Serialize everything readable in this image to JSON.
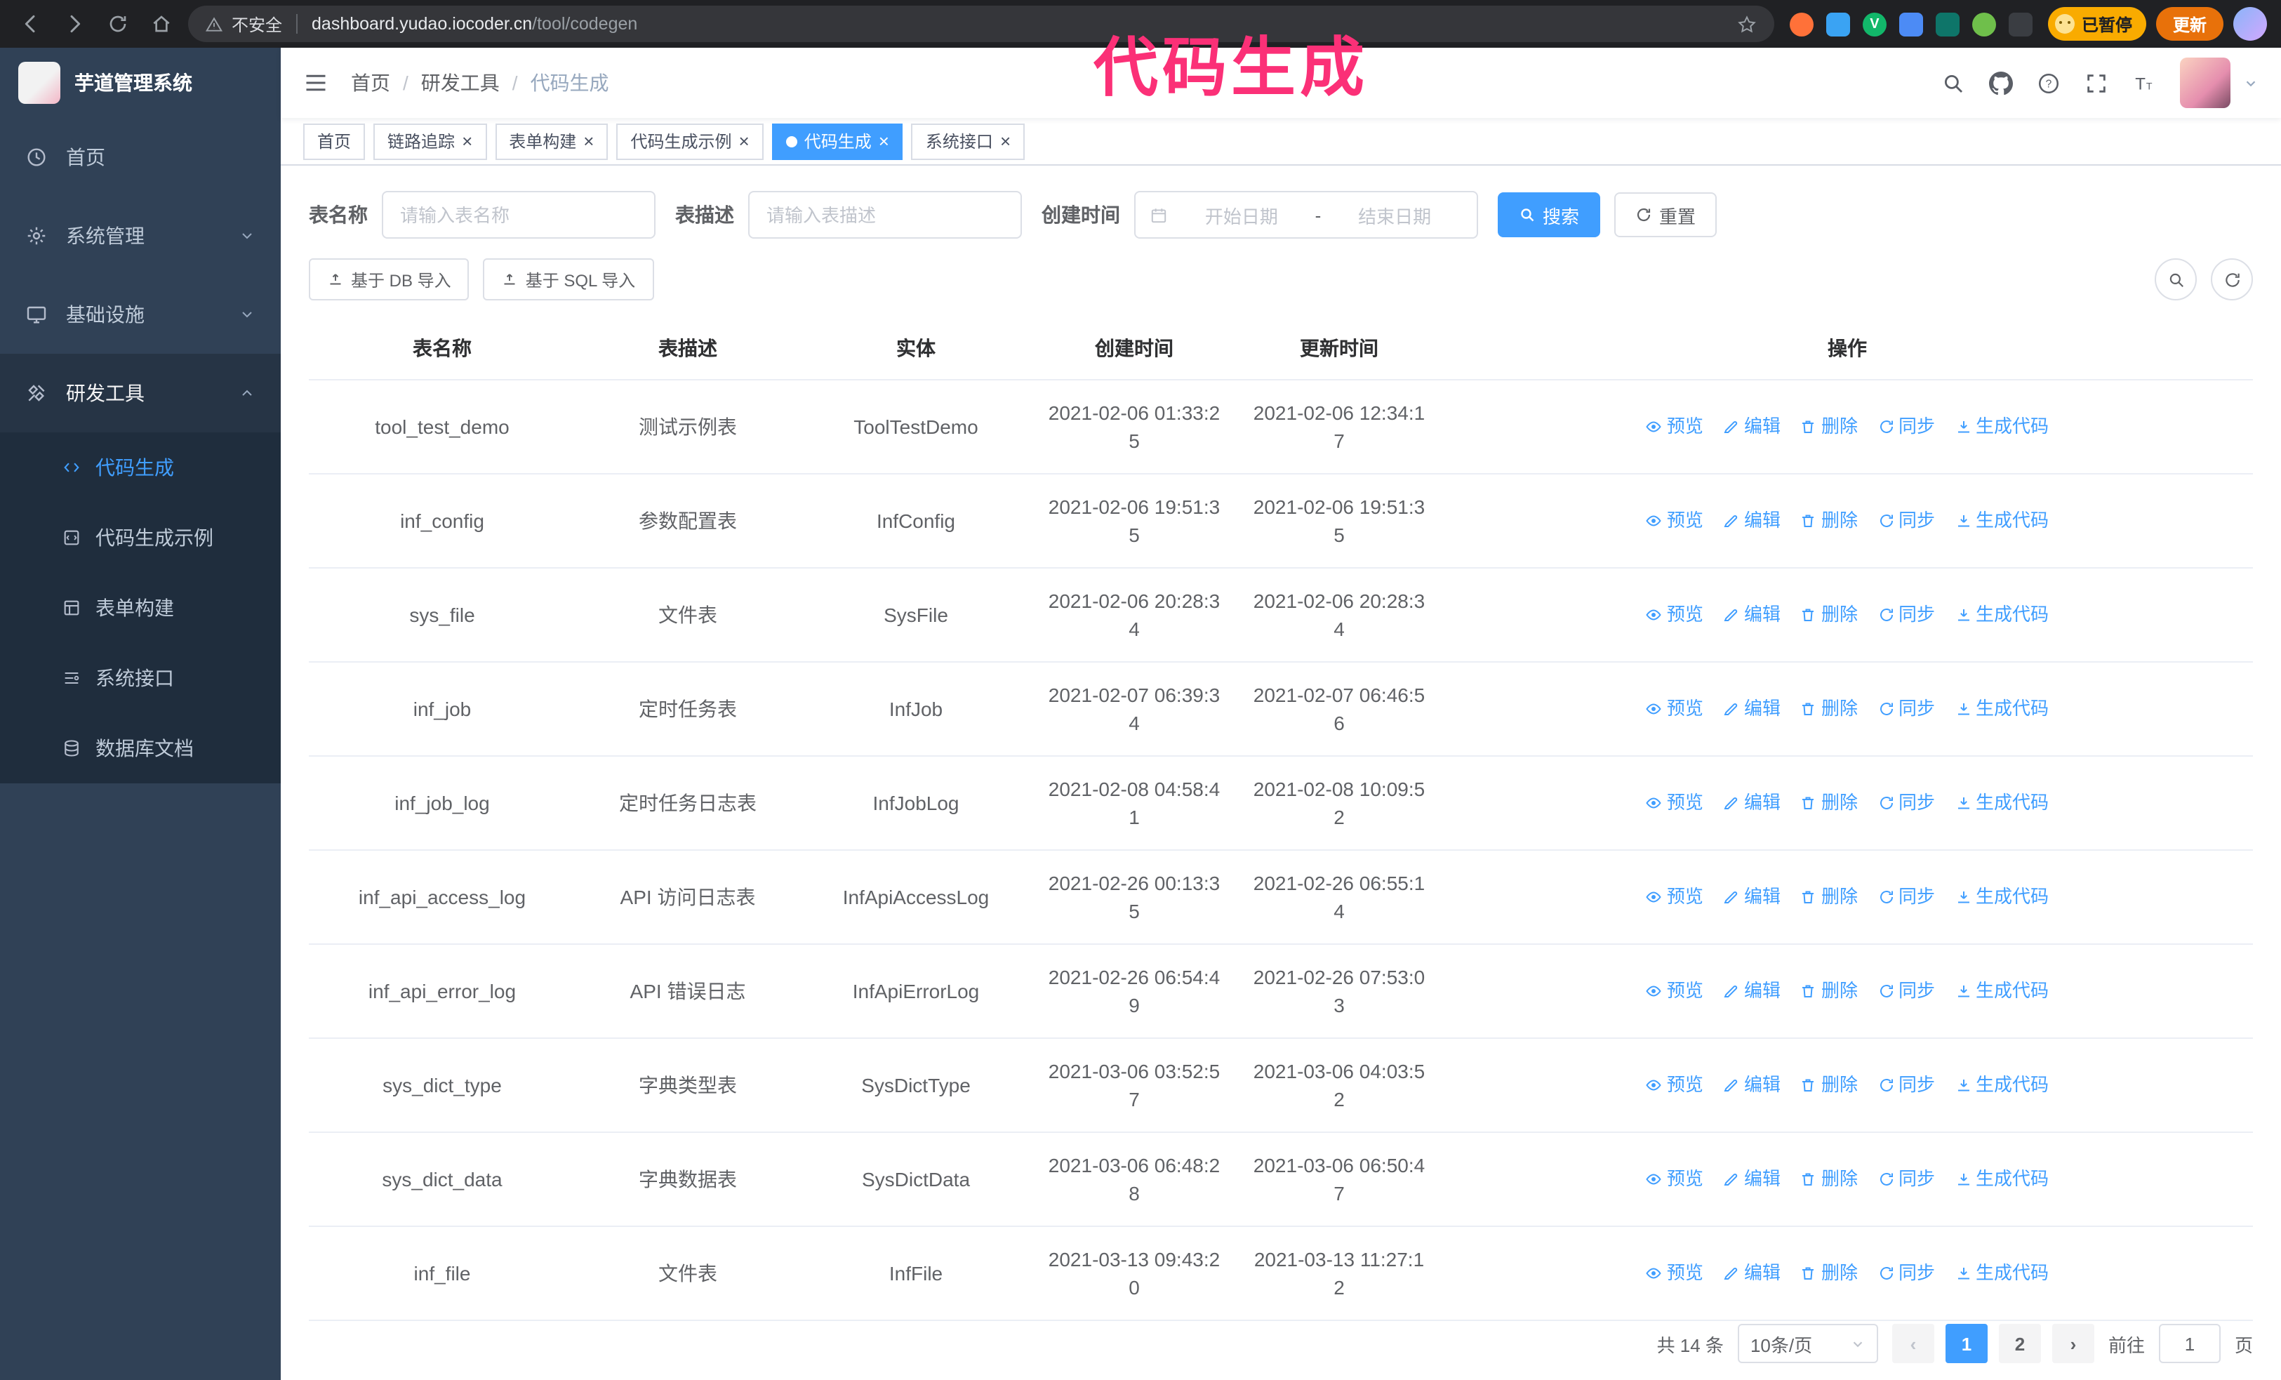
{
  "colors": {
    "accent": "#409eff",
    "annotation": "#fb3077",
    "sidebar_bg": "#304156",
    "submenu_bg": "#1f2d3d"
  },
  "annotation": {
    "title": "代码生成"
  },
  "browser": {
    "security_label": "不安全",
    "url_host": "dashboard.yudao.iocoder.cn",
    "url_path": "/tool/codegen",
    "paused_badge": "已暂停",
    "update_button": "更新",
    "extensions": [
      {
        "color": "#ff7139",
        "shape": "circle"
      },
      {
        "color": "#3aa3f3",
        "shape": "square"
      },
      {
        "color": "#12b76a",
        "shape": "circle",
        "letter": "V"
      },
      {
        "color": "#4c8bf5",
        "shape": "square"
      },
      {
        "color": "#0e7569",
        "shape": "square"
      },
      {
        "color": "#6fbf4b",
        "shape": "circle"
      },
      {
        "color": "#3a3d42",
        "shape": "square"
      }
    ]
  },
  "sidebar": {
    "logo_title": "芋道管理系统",
    "menu": [
      {
        "label": "首页",
        "icon": "dashboard",
        "expandable": false,
        "expanded": false
      },
      {
        "label": "系统管理",
        "icon": "gear",
        "expandable": true,
        "expanded": false
      },
      {
        "label": "基础设施",
        "icon": "monitor",
        "expandable": true,
        "expanded": false
      },
      {
        "label": "研发工具",
        "icon": "tools",
        "expandable": true,
        "expanded": true,
        "children": [
          {
            "label": "代码生成",
            "icon": "code",
            "active": true
          },
          {
            "label": "代码生成示例",
            "icon": "example",
            "active": false
          },
          {
            "label": "表单构建",
            "icon": "form",
            "active": false
          },
          {
            "label": "系统接口",
            "icon": "api",
            "active": false
          },
          {
            "label": "数据库文档",
            "icon": "database",
            "active": false
          }
        ]
      }
    ]
  },
  "topbar": {
    "breadcrumb": [
      "首页",
      "研发工具",
      "代码生成"
    ]
  },
  "tabs": [
    {
      "label": "首页",
      "closable": false,
      "active": false
    },
    {
      "label": "链路追踪",
      "closable": true,
      "active": false
    },
    {
      "label": "表单构建",
      "closable": true,
      "active": false
    },
    {
      "label": "代码生成示例",
      "closable": true,
      "active": false
    },
    {
      "label": "代码生成",
      "closable": true,
      "active": true
    },
    {
      "label": "系统接口",
      "closable": true,
      "active": false
    }
  ],
  "filters": {
    "table_name_label": "表名称",
    "table_name_placeholder": "请输入表名称",
    "table_desc_label": "表描述",
    "table_desc_placeholder": "请输入表描述",
    "create_time_label": "创建时间",
    "date_start_placeholder": "开始日期",
    "date_separator": "-",
    "date_end_placeholder": "结束日期",
    "search_button": "搜索",
    "reset_button": "重置"
  },
  "toolbar": {
    "import_db_button": "基于 DB 导入",
    "import_sql_button": "基于 SQL 导入"
  },
  "table": {
    "columns": [
      "表名称",
      "表描述",
      "实体",
      "创建时间",
      "更新时间",
      "操作"
    ],
    "actions": [
      {
        "label": "预览",
        "icon": "eye"
      },
      {
        "label": "编辑",
        "icon": "edit"
      },
      {
        "label": "删除",
        "icon": "delete"
      },
      {
        "label": "同步",
        "icon": "sync"
      },
      {
        "label": "生成代码",
        "icon": "download"
      }
    ],
    "rows": [
      {
        "name": "tool_test_demo",
        "desc": "测试示例表",
        "entity": "ToolTestDemo",
        "created": "2021-02-06 01:33:25",
        "updated": "2021-02-06 12:34:17"
      },
      {
        "name": "inf_config",
        "desc": "参数配置表",
        "entity": "InfConfig",
        "created": "2021-02-06 19:51:35",
        "updated": "2021-02-06 19:51:35"
      },
      {
        "name": "sys_file",
        "desc": "文件表",
        "entity": "SysFile",
        "created": "2021-02-06 20:28:34",
        "updated": "2021-02-06 20:28:34"
      },
      {
        "name": "inf_job",
        "desc": "定时任务表",
        "entity": "InfJob",
        "created": "2021-02-07 06:39:34",
        "updated": "2021-02-07 06:46:56"
      },
      {
        "name": "inf_job_log",
        "desc": "定时任务日志表",
        "entity": "InfJobLog",
        "created": "2021-02-08 04:58:41",
        "updated": "2021-02-08 10:09:52"
      },
      {
        "name": "inf_api_access_log",
        "desc": "API 访问日志表",
        "entity": "InfApiAccessLog",
        "created": "2021-02-26 00:13:35",
        "updated": "2021-02-26 06:55:14"
      },
      {
        "name": "inf_api_error_log",
        "desc": "API 错误日志",
        "entity": "InfApiErrorLog",
        "created": "2021-02-26 06:54:49",
        "updated": "2021-02-26 07:53:03"
      },
      {
        "name": "sys_dict_type",
        "desc": "字典类型表",
        "entity": "SysDictType",
        "created": "2021-03-06 03:52:57",
        "updated": "2021-03-06 04:03:52"
      },
      {
        "name": "sys_dict_data",
        "desc": "字典数据表",
        "entity": "SysDictData",
        "created": "2021-03-06 06:48:28",
        "updated": "2021-03-06 06:50:47"
      },
      {
        "name": "inf_file",
        "desc": "文件表",
        "entity": "InfFile",
        "created": "2021-03-13 09:43:20",
        "updated": "2021-03-13 11:27:12"
      }
    ]
  },
  "pagination": {
    "total_text": "共 14 条",
    "page_size": "10条/页",
    "pages": [
      "1",
      "2"
    ],
    "active_page": "1",
    "goto_label": "前往",
    "goto_value": "1",
    "goto_unit": "页"
  }
}
